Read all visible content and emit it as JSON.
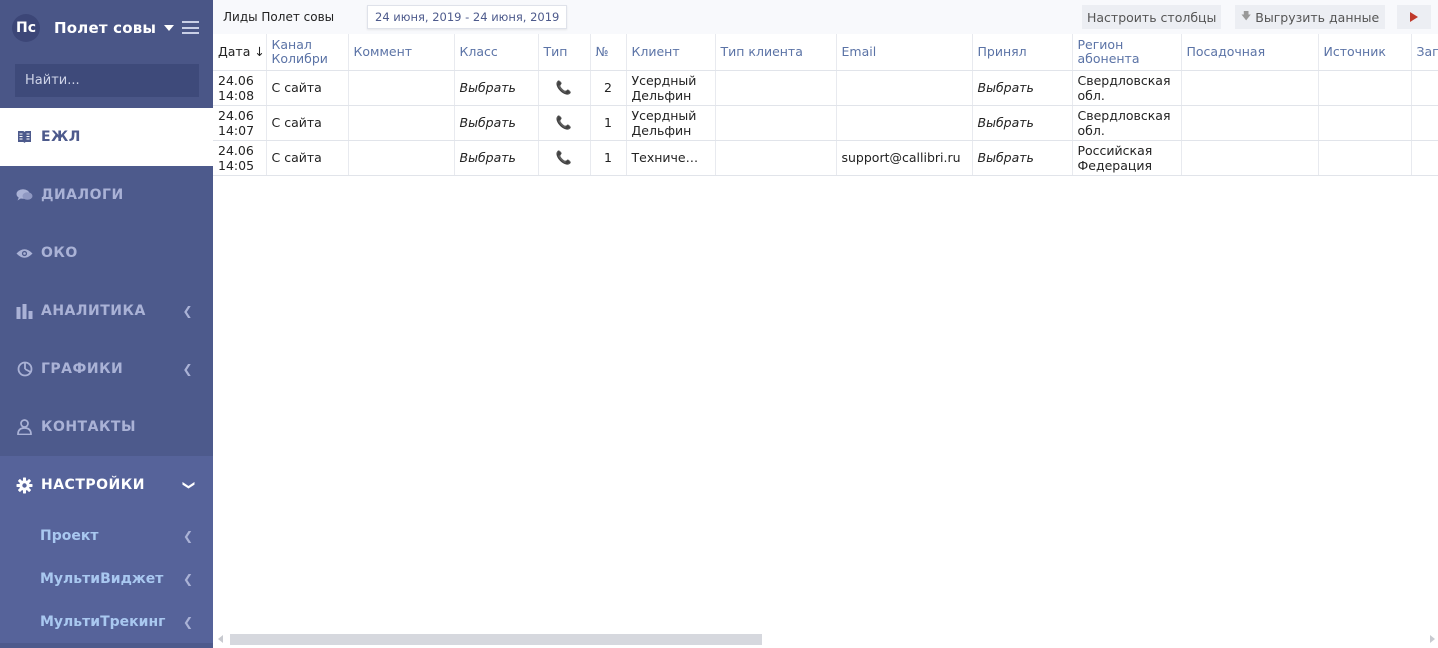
{
  "sidebar": {
    "logo_text": "Пс",
    "project_name": "Полет совы",
    "search_placeholder": "Найти...",
    "nav": [
      {
        "label": "ЕЖЛ",
        "icon": "book-icon"
      },
      {
        "label": "ДИАЛОГИ",
        "icon": "chat-icon"
      },
      {
        "label": "ОКО",
        "icon": "eye-icon"
      },
      {
        "label": "АНАЛИТИКА",
        "icon": "bar-chart-icon"
      },
      {
        "label": "ГРАФИКИ",
        "icon": "pie-chart-icon"
      },
      {
        "label": "КОНТАКТЫ",
        "icon": "user-icon"
      },
      {
        "label": "НАСТРОЙКИ",
        "icon": "gear-icon"
      }
    ],
    "sub_items": [
      "Проект",
      "МультиВиджет",
      "МультиТрекинг"
    ]
  },
  "topbar": {
    "title": "Лиды Полет совы",
    "date_range": "24 июня, 2019 - 24 июня, 2019",
    "columns_button": "Настроить столбцы",
    "export_button": "Выгрузить данные"
  },
  "table": {
    "headers": [
      "Дата",
      "Канал Колибри",
      "Коммент",
      "Класс",
      "Тип",
      "№",
      "Клиент",
      "Тип клиента",
      "Email",
      "Принял",
      "Регион абонента",
      "Посадочная",
      "Источник",
      "Заг"
    ],
    "sort_indicator": "↓",
    "rows": [
      {
        "date": "24.06",
        "time": "14:08",
        "channel": "С сайта",
        "comment": "",
        "class": "Выбрать",
        "type": "phone-icon",
        "num": "2",
        "client": "Усердный Дельфин",
        "client_type": "",
        "email": "",
        "accepted": "Выбрать",
        "region": "Свердловская обл.",
        "landing": "",
        "source": "",
        "extra": ""
      },
      {
        "date": "24.06",
        "time": "14:07",
        "channel": "С сайта",
        "comment": "",
        "class": "Выбрать",
        "type": "phone-icon",
        "num": "1",
        "client": "Усердный Дельфин",
        "client_type": "",
        "email": "",
        "accepted": "Выбрать",
        "region": "Свердловская обл.",
        "landing": "",
        "source": "",
        "extra": ""
      },
      {
        "date": "24.06",
        "time": "14:05",
        "channel": "С сайта",
        "comment": "",
        "class": "Выбрать",
        "type": "phone-icon",
        "num": "1",
        "client": "Техниче…",
        "client_type": "",
        "email": "support@callibri.ru",
        "accepted": "Выбрать",
        "region": "Российская Федерация",
        "landing": "",
        "source": "",
        "extra": ""
      }
    ]
  }
}
